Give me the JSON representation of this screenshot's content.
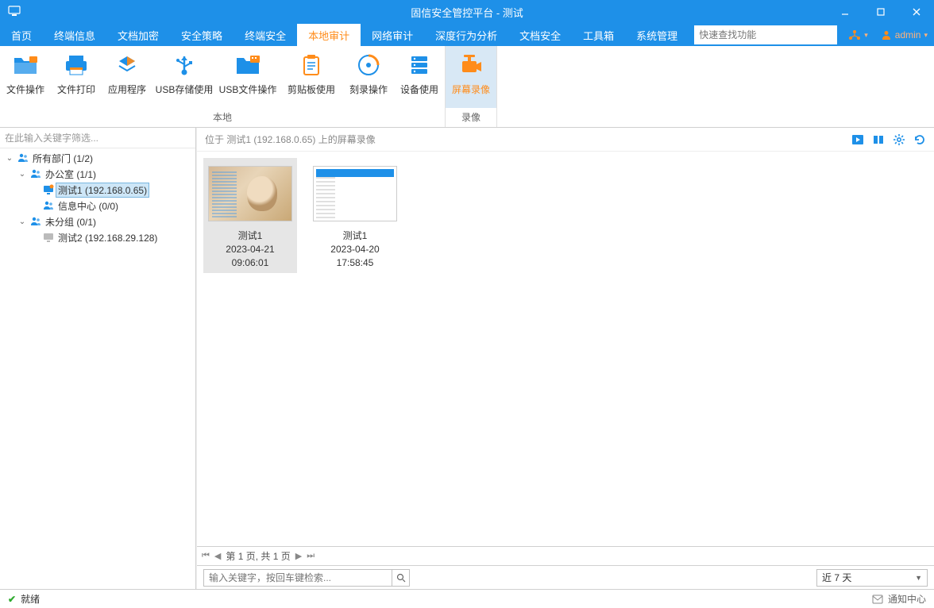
{
  "window": {
    "title": "固信安全管控平台 - 测试",
    "user": "admin"
  },
  "menu": {
    "items": [
      "首页",
      "终端信息",
      "文档加密",
      "安全策略",
      "终端安全",
      "本地审计",
      "网络审计",
      "深度行为分析",
      "文档安全",
      "工具箱",
      "系统管理"
    ],
    "active_index": 5,
    "search_placeholder": "快速查找功能"
  },
  "ribbon": {
    "groups": [
      {
        "label": "本地",
        "items": [
          {
            "label": "文件操作",
            "icon": "folder"
          },
          {
            "label": "文件打印",
            "icon": "printer"
          },
          {
            "label": "应用程序",
            "icon": "apps"
          },
          {
            "label": "USB存储使用",
            "icon": "usb"
          },
          {
            "label": "USB文件操作",
            "icon": "usb-folder"
          },
          {
            "label": "剪贴板使用",
            "icon": "clipboard"
          },
          {
            "label": "刻录操作",
            "icon": "disc"
          },
          {
            "label": "设备使用",
            "icon": "server"
          }
        ]
      },
      {
        "label": "录像",
        "items": [
          {
            "label": "屏幕录像",
            "icon": "camera",
            "active": true
          }
        ]
      }
    ]
  },
  "sidebar": {
    "filter_placeholder": "在此输入关键字筛选...",
    "tree": [
      {
        "indent": 0,
        "expanded": true,
        "icon": "people",
        "label": "所有部门 (1/2)"
      },
      {
        "indent": 1,
        "expanded": true,
        "icon": "people",
        "label": "办公室 (1/1)"
      },
      {
        "indent": 2,
        "expanded": null,
        "icon": "monitor-on",
        "label": "测试1 (192.168.0.65)",
        "selected": true
      },
      {
        "indent": 2,
        "expanded": null,
        "icon": "people",
        "label": "信息中心 (0/0)"
      },
      {
        "indent": 1,
        "expanded": true,
        "icon": "people",
        "label": "未分组 (0/1)"
      },
      {
        "indent": 2,
        "expanded": null,
        "icon": "monitor-off",
        "label": "测试2 (192.168.29.128)"
      }
    ]
  },
  "content": {
    "header": "位于 测试1 (192.168.0.65) 上的屏幕录像",
    "actions": [
      "play",
      "list",
      "settings",
      "refresh"
    ],
    "thumbnails": [
      {
        "name": "测试1",
        "date": "2023-04-21",
        "time": "09:06:01",
        "style": "artwork",
        "selected": true
      },
      {
        "name": "测试1",
        "date": "2023-04-20",
        "time": "17:58:45",
        "style": "app",
        "selected": false
      }
    ],
    "pager": "第 1 页,  共 1 页",
    "keyword_placeholder": "输入关键字，按回车键检索...",
    "range": "近 7 天"
  },
  "status": {
    "text": "就绪",
    "notify": "通知中心"
  }
}
